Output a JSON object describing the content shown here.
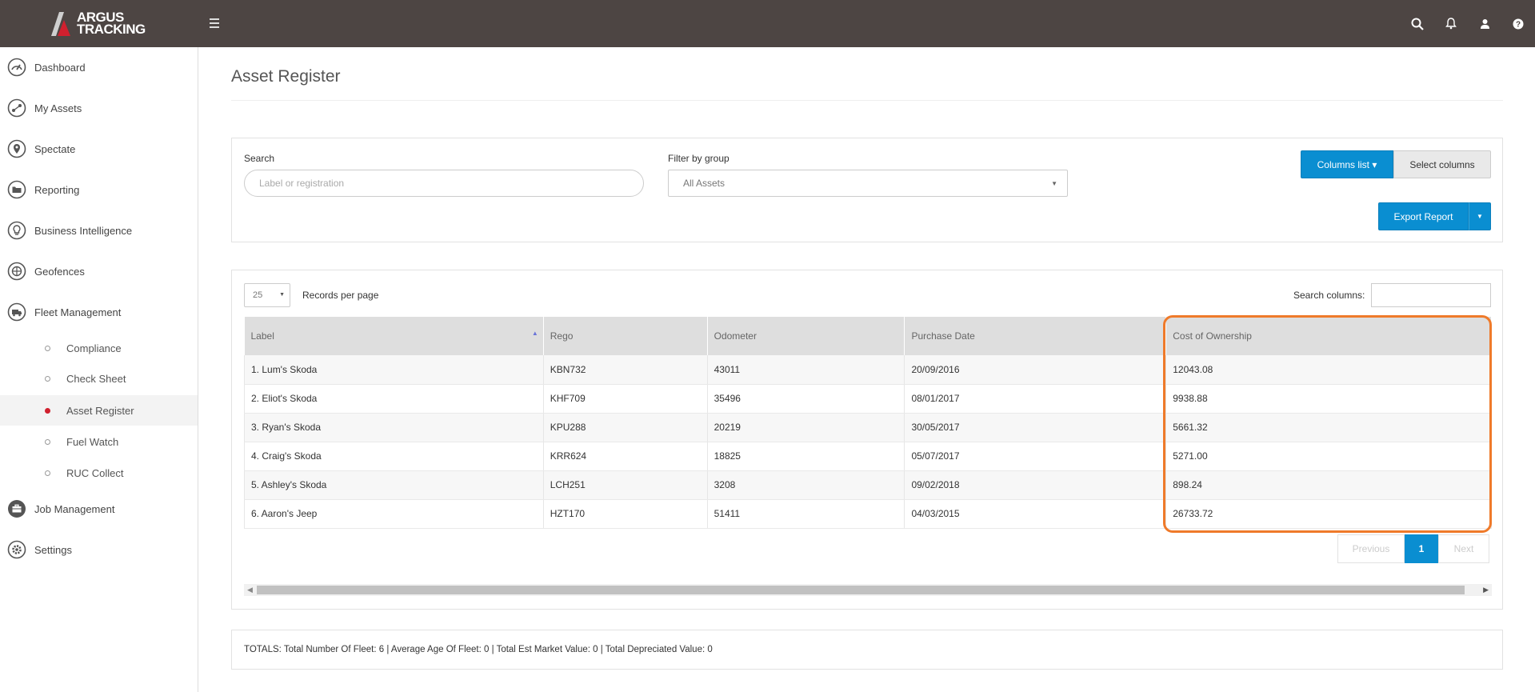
{
  "app": {
    "logo_line1": "ARGUS",
    "logo_line2": "TRACKING"
  },
  "topbar": {
    "icons": [
      "search-icon",
      "bell-icon",
      "user-icon",
      "help-icon"
    ]
  },
  "sidebar": {
    "items": [
      {
        "label": "Dashboard",
        "icon": "speedometer-icon"
      },
      {
        "label": "My Assets",
        "icon": "assets-icon"
      },
      {
        "label": "Spectate",
        "icon": "map-pin-icon"
      },
      {
        "label": "Reporting",
        "icon": "folder-icon"
      },
      {
        "label": "Business Intelligence",
        "icon": "lightbulb-icon"
      },
      {
        "label": "Geofences",
        "icon": "globe-icon"
      },
      {
        "label": "Fleet Management",
        "icon": "truck-icon"
      },
      {
        "label": "Job Management",
        "icon": "briefcase-icon"
      },
      {
        "label": "Settings",
        "icon": "gear-icon"
      }
    ],
    "fleet_sub": [
      {
        "label": "Compliance",
        "active": false
      },
      {
        "label": "Check Sheet",
        "active": false
      },
      {
        "label": "Asset Register",
        "active": true
      },
      {
        "label": "Fuel Watch",
        "active": false
      },
      {
        "label": "RUC Collect",
        "active": false
      }
    ]
  },
  "page": {
    "title": "Asset Register"
  },
  "filters": {
    "search_label": "Search",
    "search_placeholder": "Label or registration",
    "group_label": "Filter by group",
    "group_value": "All Assets",
    "columns_list_label": "Columns list ▾",
    "select_columns_label": "Select columns",
    "export_label": "Export Report"
  },
  "table": {
    "per_page_value": "25",
    "per_page_label": "Records per page",
    "search_columns_label": "Search columns:",
    "columns": [
      "Label",
      "Rego",
      "Odometer",
      "Purchase Date",
      "Cost of Ownership"
    ],
    "rows": [
      [
        "1. Lum's Skoda",
        "KBN732",
        "43011",
        "20/09/2016",
        "12043.08"
      ],
      [
        "2. Eliot's Skoda",
        "KHF709",
        "35496",
        "08/01/2017",
        "9938.88"
      ],
      [
        "3. Ryan's Skoda",
        "KPU288",
        "20219",
        "30/05/2017",
        "5661.32"
      ],
      [
        "4. Craig's Skoda",
        "KRR624",
        "18825",
        "05/07/2017",
        "5271.00"
      ],
      [
        "5. Ashley's Skoda",
        "LCH251",
        "3208",
        "09/02/2018",
        "898.24"
      ],
      [
        "6. Aaron's Jeep",
        "HZT170",
        "51411",
        "04/03/2015",
        "26733.72"
      ]
    ],
    "pager": {
      "previous": "Previous",
      "current": "1",
      "next": "Next"
    }
  },
  "totals": {
    "text": "TOTALS: Total Number Of Fleet: 6 | Average Age Of Fleet: 0 | Total Est Market Value: 0 | Total Depreciated Value: 0"
  },
  "colors": {
    "topbar": "#4d4543",
    "primary": "#0a8ed1",
    "highlight": "#ef7a2a",
    "active_dot": "#d0202e"
  }
}
